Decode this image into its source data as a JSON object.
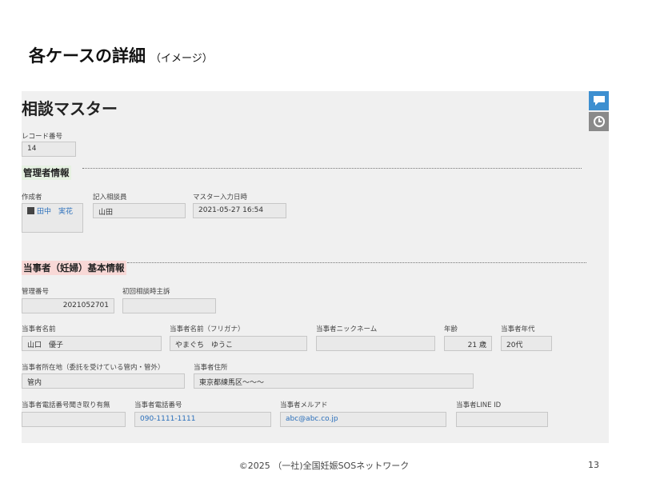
{
  "slide": {
    "title": "各ケースの詳細",
    "subtitle": "（イメージ）",
    "footer": "©2025 （一社)全国妊娠SOSネットワーク",
    "page_number": "13"
  },
  "app": {
    "title": "相談マスター"
  },
  "record": {
    "label": "レコード番号",
    "value": "14"
  },
  "manager_section": {
    "title": "管理者情報",
    "creator_label": "作成者",
    "creator_value": "田中　実花",
    "recorder_label": "記入相談員",
    "recorder_value": "山田",
    "master_input_label": "マスター入力日時",
    "master_input_value": "2021-05-27 16:54"
  },
  "party_section": {
    "title": "当事者（妊婦）基本情報",
    "mgmt_no_label": "管理番号",
    "mgmt_no_value": "2021052701",
    "first_consult_label": "初回相談時主訴",
    "first_consult_value": "",
    "name_label": "当事者名前",
    "name_value": "山口　優子",
    "furigana_label": "当事者名前（フリガナ）",
    "furigana_value": "やまぐち　ゆうこ",
    "nickname_label": "当事者ニックネーム",
    "nickname_value": "",
    "age_label": "年齢",
    "age_value": "21 歳",
    "age_group_label": "当事者年代",
    "age_group_value": "20代",
    "location_label": "当事者所在地（委託を受けている管内・管外）",
    "location_value": "管内",
    "address_label": "当事者住所",
    "address_value": "東京都練馬区～～～",
    "phone_listen_label": "当事者電話番号聞き取り有無",
    "phone_listen_value": "",
    "phone_label": "当事者電話番号",
    "phone_value": "090-1111-1111",
    "email_label": "当事者メルアド",
    "email_value": "abc@abc.co.jp",
    "line_label": "当事者LINE ID",
    "line_value": ""
  },
  "side_buttons": {
    "comment_icon": "speech-bubble-icon",
    "history_icon": "clock-history-icon"
  },
  "colors": {
    "comment_btn": "#3d8fd0",
    "history_btn": "#8a8a8a",
    "green_band": "#e6f1e2",
    "pink_band": "#f8d8d6"
  }
}
